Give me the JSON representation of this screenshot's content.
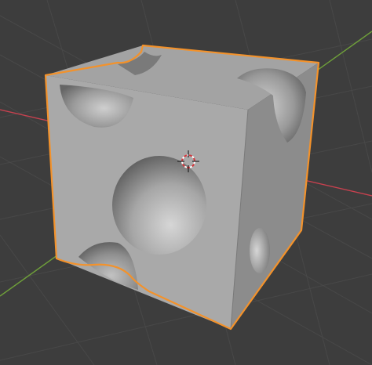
{
  "viewport": {
    "background": "#3d3d3d",
    "grid_color": "#4a4a4a",
    "axis_x_color": "#c8414f",
    "axis_y_color": "#6fa03a",
    "selection_outline_color": "#f3922b"
  },
  "object": {
    "shape": "cube with spherical cavities",
    "selected": true,
    "face_colors": {
      "front": "#a9a9a9",
      "top": "#a3a3a3",
      "right": "#8a8a8a"
    }
  },
  "cursor": {
    "icon": "3d-cursor-icon"
  }
}
